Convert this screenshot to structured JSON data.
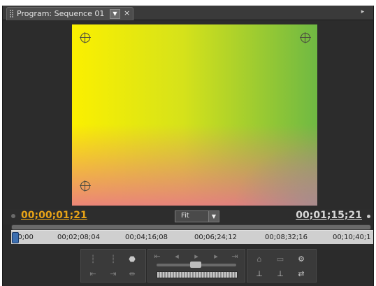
{
  "panel": {
    "tab_title": "Program: Sequence 01",
    "menu_glyph": "▼",
    "close_glyph": "×",
    "flyout_glyph": "▸"
  },
  "timecode": {
    "current": "00;00;01;21",
    "duration": "00;01;15;21"
  },
  "zoom": {
    "selected": "Fit",
    "arrow": "▼"
  },
  "ruler": {
    "ticks": [
      "00;00",
      "00;02;08;04",
      "00;04;16;08",
      "00;06;24;12",
      "00;08;32;16",
      "00;10;40;1"
    ]
  },
  "icons": {
    "tab_grip": "grip-icon",
    "crosshair": "crosshair-icon"
  },
  "colors": {
    "current_timecode": "#e8a317",
    "frame_yellow": "#fbf000",
    "frame_green": "#6fb943",
    "frame_pink": "#e9738c"
  }
}
